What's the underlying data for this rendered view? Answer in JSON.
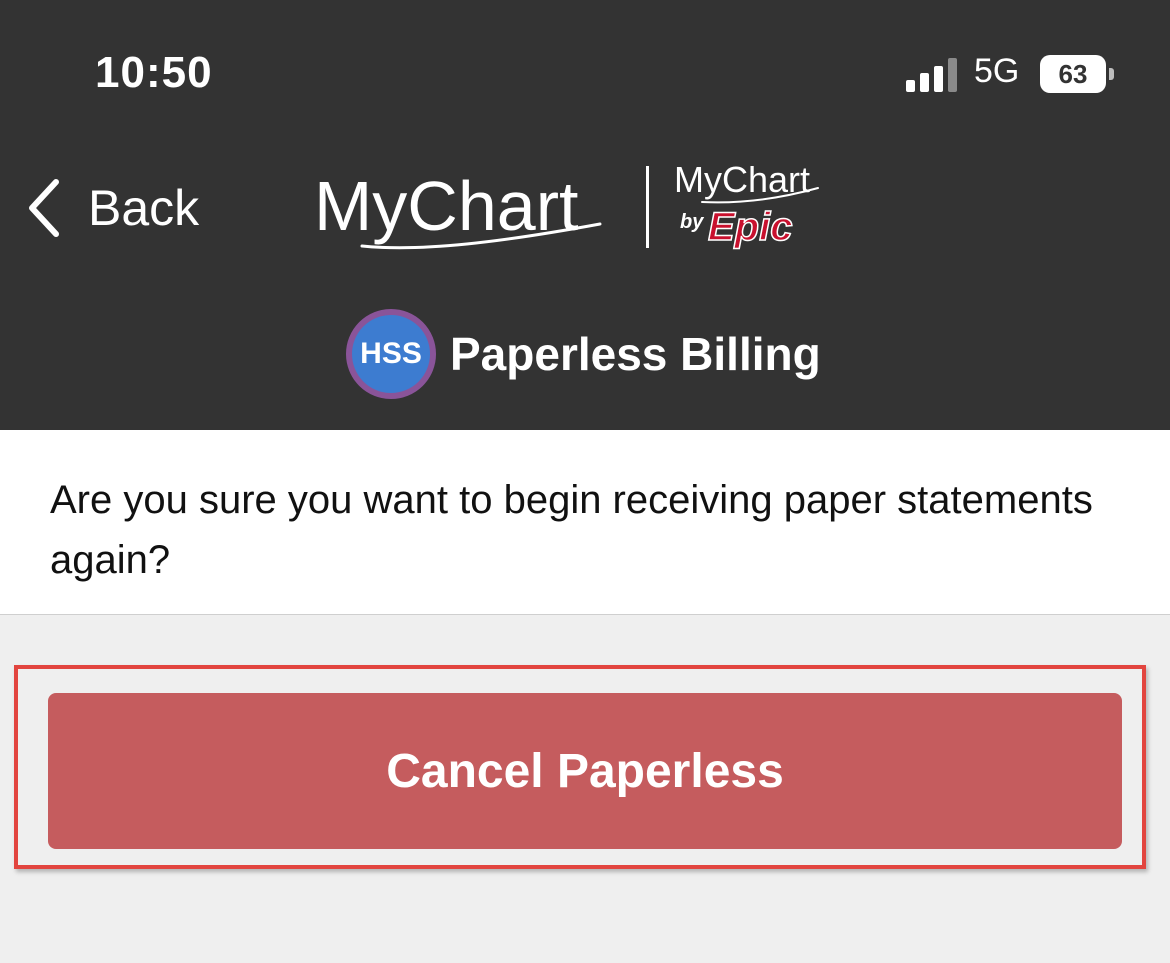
{
  "status_bar": {
    "time": "10:50",
    "network": "5G",
    "battery": "63"
  },
  "header": {
    "back_label": "Back",
    "logo_primary": "MyChart",
    "logo_secondary": "MyChart",
    "logo_by": "by",
    "logo_epic": "Epic",
    "org_badge": "HSS",
    "title": "Paperless Billing"
  },
  "content": {
    "question": "Are you sure you want to begin receiving paper statements again?"
  },
  "actions": {
    "cancel_label": "Cancel Paperless"
  },
  "colors": {
    "header_bg": "#333333",
    "button_bg": "#c55c5e",
    "highlight_border": "#e2453f",
    "epic_red": "#c8102e",
    "badge_blue": "#3d7cd0",
    "badge_ring": "#8a5499"
  }
}
